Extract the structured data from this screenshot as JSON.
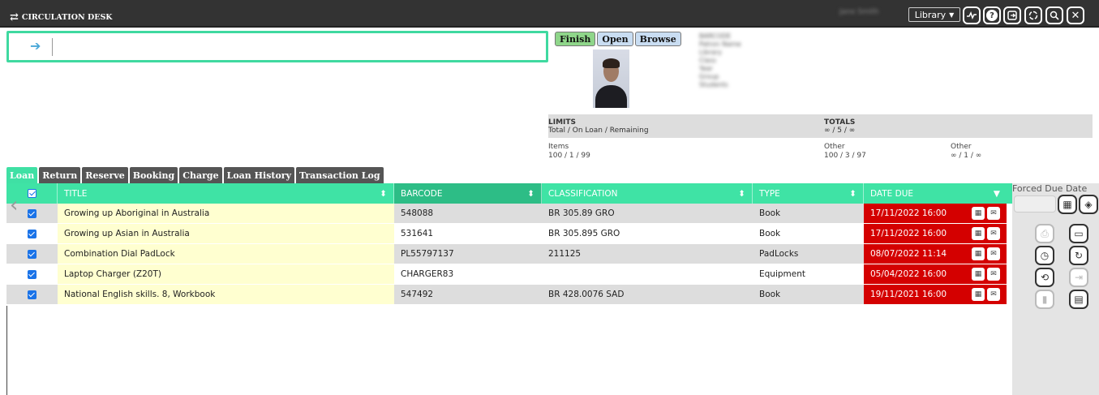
{
  "header": {
    "title": "CIRCULATION DESK",
    "user_name": "Jane Smith",
    "library_select": "Library",
    "icons": [
      "activity-icon",
      "help-icon",
      "logout-icon",
      "sync-icon",
      "search-icon",
      "close-icon"
    ]
  },
  "scan": {
    "placeholder": ""
  },
  "patron_buttons": {
    "finish": "Finish",
    "open": "Open",
    "browse": "Browse"
  },
  "patron_info": [
    "BARCODE",
    "Patron Name",
    "Library",
    "Class",
    "Year",
    "Group",
    "Students"
  ],
  "limits": {
    "limits_label": "LIMITS",
    "limits_sub": "Total / On Loan / Remaining",
    "totals_label": "TOTALS",
    "totals_value": "∞ / 5 / ∞",
    "items_label": "Items",
    "items_value": "100 / 1 / 99",
    "other1_label": "Other",
    "other1_value": "100 / 3 / 97",
    "other2_label": "Other",
    "other2_value": "∞ / 1 / ∞"
  },
  "tabs": [
    "Loan",
    "Return",
    "Reserve",
    "Booking",
    "Charge",
    "Loan History",
    "Transaction Log"
  ],
  "table": {
    "columns": [
      "TITLE",
      "BARCODE",
      "CLASSIFICATION",
      "TYPE",
      "DATE DUE"
    ],
    "rows": [
      {
        "title": "Growing up Aboriginal in Australia",
        "barcode": "548088",
        "classification": "BR 305.89 GRO",
        "type": "Book",
        "due": "17/11/2022 16:00"
      },
      {
        "title": "Growing up Asian in Australia",
        "barcode": "531641",
        "classification": "BR 305.895 GRO",
        "type": "Book",
        "due": "17/11/2022 16:00"
      },
      {
        "title": "Combination Dial PadLock",
        "barcode": "PL55797137",
        "classification": "211125",
        "type": "PadLocks",
        "due": "08/07/2022 11:14"
      },
      {
        "title": "Laptop Charger (Z20T)",
        "barcode": "CHARGER83",
        "classification": "",
        "type": "Equipment",
        "due": "05/04/2022 16:00"
      },
      {
        "title": "National English skills. 8, Workbook",
        "barcode": "547492",
        "classification": "BR 428.0076 SAD",
        "type": "Book",
        "due": "19/11/2021 16:00"
      }
    ]
  },
  "side": {
    "forced_due_label": "Forced Due Date"
  },
  "colors": {
    "accent": "#3fe3a5",
    "overdue": "#d40000",
    "topbar": "#333333",
    "title_bg": "#ffffd0"
  }
}
